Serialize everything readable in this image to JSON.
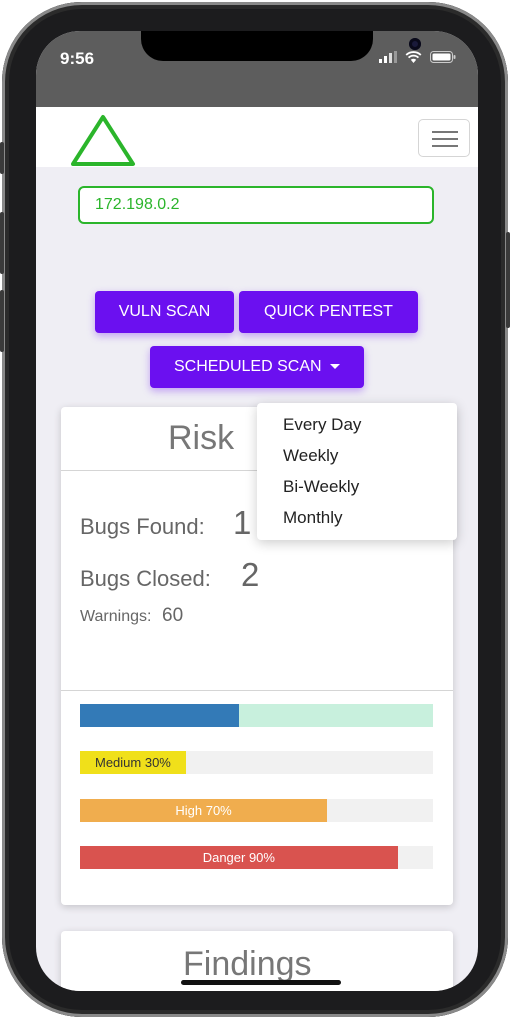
{
  "status_bar": {
    "time": "9:56"
  },
  "navbar": {
    "logo_icon": "triangle-logo-icon",
    "menu_icon": "hamburger-menu-icon"
  },
  "target_input": {
    "value": "172.198.0.2"
  },
  "actions": {
    "vuln_scan": "VULN SCAN",
    "quick_pentest": "QUICK PENTEST",
    "scheduled_scan": "SCHEDULED SCAN"
  },
  "schedule_menu": {
    "items": [
      "Every Day",
      "Weekly",
      "Bi-Weekly",
      "Monthly"
    ]
  },
  "risk_card": {
    "title_visible": "Risk",
    "bugs_found_label": "Bugs Found:",
    "bugs_found_value_visible": "1",
    "bugs_closed_label": "Bugs Closed:",
    "bugs_closed_value": "2",
    "warnings_label": "Warnings:",
    "warnings_value": "60"
  },
  "bars": [
    {
      "label": "",
      "fraction": 0.45,
      "color": "#337ab7",
      "track_color": "#c8f0dd"
    },
    {
      "label": "Medium 30%",
      "fraction": 0.3,
      "color": "#f0e01a",
      "track_color": "#f1f1f1"
    },
    {
      "label": "High 70%",
      "fraction": 0.7,
      "color": "#f0ad4e",
      "track_color": "#f1f1f1"
    },
    {
      "label": "Danger 90%",
      "fraction": 0.9,
      "color": "#d9534f",
      "track_color": "#f1f1f1"
    }
  ],
  "findings_card": {
    "title": "Findings"
  },
  "colors": {
    "accent": "#6b10f0",
    "success": "#2bb52b"
  }
}
